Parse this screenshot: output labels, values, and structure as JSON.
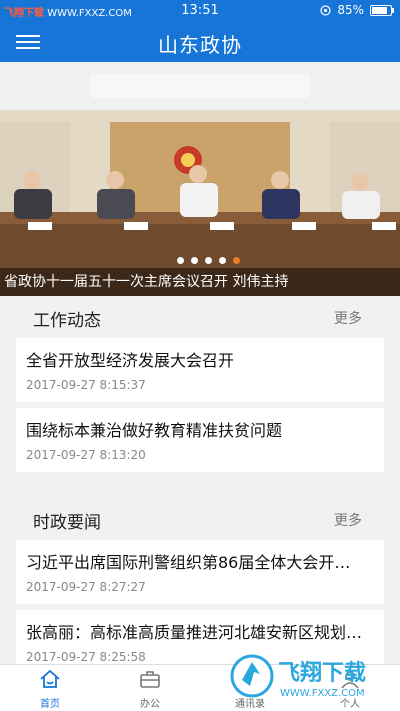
{
  "status": {
    "watermark_prefix": "飞翔下载",
    "watermark_url": "WWW.FXXZ.COM",
    "time": "13:51",
    "battery": "85%"
  },
  "header": {
    "title": "山东政协"
  },
  "banner": {
    "caption": "省政协十一届五十一次主席会议召开 刘伟主持",
    "dot_count": 5,
    "active_dot": 4
  },
  "sections": {
    "work": {
      "title": "工作动态",
      "more": "更多",
      "items": [
        {
          "title": "全省开放型经济发展大会召开",
          "date": "2017-09-27 8:15:37"
        },
        {
          "title": "围绕标本兼治做好教育精准扶贫问题",
          "date": "2017-09-27 8:13:20"
        }
      ]
    },
    "news": {
      "title": "时政要闻",
      "more": "更多",
      "items": [
        {
          "title": "习近平出席国际刑警组织第86届全体大会开…",
          "date": "2017-09-27 8:27:27"
        },
        {
          "title": "张高丽：高标准高质量推进河北雄安新区规划…",
          "date": "2017-09-27 8:25:58"
        }
      ]
    }
  },
  "tabs": [
    {
      "label": "首页",
      "icon": "home-icon"
    },
    {
      "label": "办公",
      "icon": "briefcase-icon"
    },
    {
      "label": "通讯录",
      "icon": "contacts-icon"
    },
    {
      "label": "个人",
      "icon": "person-icon"
    }
  ],
  "active_tab": 0,
  "watermark": {
    "text": "飞翔下载",
    "url": "WWW.FXXZ.COM"
  },
  "colors": {
    "primary": "#1675d6",
    "accent": "#ee7d1f"
  }
}
